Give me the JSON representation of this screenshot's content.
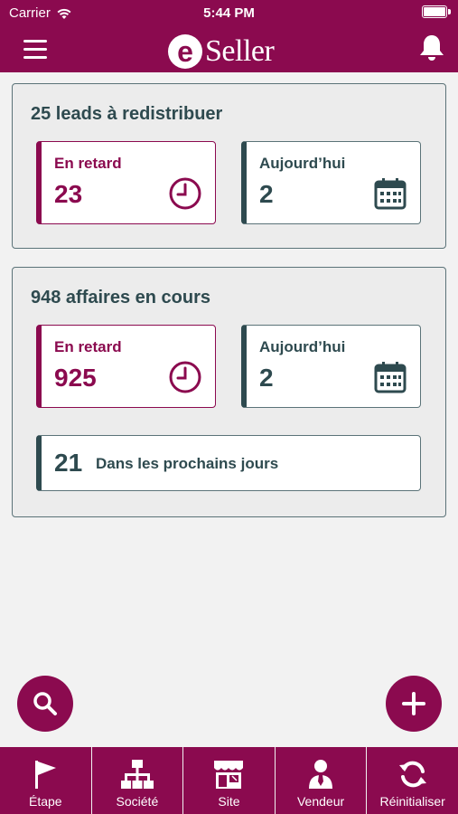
{
  "status_bar": {
    "carrier": "Carrier",
    "time": "5:44 PM"
  },
  "header": {
    "logo_letter": "e",
    "logo_text": "Seller"
  },
  "leads": {
    "title": "25 leads à redistribuer",
    "late": {
      "label": "En retard",
      "value": "23"
    },
    "today": {
      "label": "Aujourd’hui",
      "value": "2"
    }
  },
  "deals": {
    "title": "948 affaires en cours",
    "late": {
      "label": "En retard",
      "value": "925"
    },
    "today": {
      "label": "Aujourd’hui",
      "value": "2"
    },
    "upcoming": {
      "value": "21",
      "label": "Dans les prochains jours"
    }
  },
  "tabs": [
    {
      "label": "Étape",
      "icon": "flag-icon"
    },
    {
      "label": "Société",
      "icon": "org-chart-icon"
    },
    {
      "label": "Site",
      "icon": "store-icon"
    },
    {
      "label": "Vendeur",
      "icon": "salesperson-icon"
    },
    {
      "label": "Réinitialiser",
      "icon": "refresh-icon"
    }
  ],
  "colors": {
    "brand": "#8b0a4f",
    "text": "#2e4a4f",
    "background": "#f2f2f2"
  }
}
